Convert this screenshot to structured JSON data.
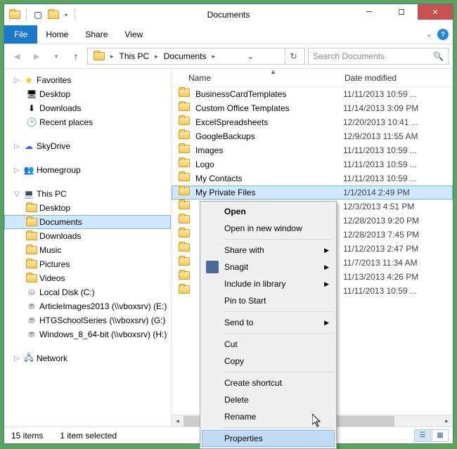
{
  "window": {
    "title": "Documents"
  },
  "ribbon": {
    "file": "File",
    "tabs": [
      "Home",
      "Share",
      "View"
    ]
  },
  "breadcrumb": {
    "root": "This PC",
    "folder": "Documents"
  },
  "search": {
    "placeholder": "Search Documents"
  },
  "nav": {
    "favorites": {
      "label": "Favorites",
      "items": [
        "Desktop",
        "Downloads",
        "Recent places"
      ]
    },
    "skydrive": {
      "label": "SkyDrive"
    },
    "homegroup": {
      "label": "Homegroup"
    },
    "thispc": {
      "label": "This PC",
      "items": [
        "Desktop",
        "Documents",
        "Downloads",
        "Music",
        "Pictures",
        "Videos",
        "Local Disk (C:)",
        "ArticleImages2013 (\\\\vboxsrv) (E:)",
        "HTGSchoolSeries (\\\\vboxsrv) (G:)",
        "Windows_8_64-bit (\\\\vboxsrv) (H:)"
      ]
    },
    "network": {
      "label": "Network"
    }
  },
  "columns": {
    "name": "Name",
    "date": "Date modified"
  },
  "files": [
    {
      "name": "BusinessCardTemplates",
      "date": "11/11/2013 10:59 ..."
    },
    {
      "name": "Custom Office Templates",
      "date": "11/14/2013 3:09 PM"
    },
    {
      "name": "ExcelSpreadsheets",
      "date": "12/20/2013 10:41 ..."
    },
    {
      "name": "GoogleBackups",
      "date": "12/9/2013 11:55 AM"
    },
    {
      "name": "Images",
      "date": "11/11/2013 10:59 ..."
    },
    {
      "name": "Logo",
      "date": "11/11/2013 10:59 ..."
    },
    {
      "name": "My Contacts",
      "date": "11/11/2013 10:59 ..."
    },
    {
      "name": "My Private Files",
      "date": "1/1/2014 2:49 PM"
    },
    {
      "name": "",
      "date": "12/3/2013 4:51 PM"
    },
    {
      "name": "",
      "date": "12/28/2013 9:20 PM"
    },
    {
      "name": "",
      "date": "12/28/2013 7:45 PM"
    },
    {
      "name": "",
      "date": "11/12/2013 2:47 PM"
    },
    {
      "name": "",
      "date": "11/7/2013 11:34 AM"
    },
    {
      "name": "",
      "date": "11/13/2013 4:26 PM"
    },
    {
      "name": "",
      "date": "11/11/2013 10:59 ..."
    }
  ],
  "selected_file_index": 7,
  "context_menu": {
    "items": [
      {
        "label": "Open",
        "bold": true
      },
      {
        "label": "Open in new window"
      },
      {
        "sep": true
      },
      {
        "label": "Share with",
        "sub": true
      },
      {
        "label": "Snagit",
        "sub": true,
        "icon": true
      },
      {
        "label": "Include in library",
        "sub": true
      },
      {
        "label": "Pin to Start"
      },
      {
        "sep": true
      },
      {
        "label": "Send to",
        "sub": true
      },
      {
        "sep": true
      },
      {
        "label": "Cut"
      },
      {
        "label": "Copy"
      },
      {
        "sep": true
      },
      {
        "label": "Create shortcut"
      },
      {
        "label": "Delete"
      },
      {
        "label": "Rename"
      },
      {
        "sep": true
      },
      {
        "label": "Properties",
        "hover": true
      }
    ]
  },
  "status": {
    "count": "15 items",
    "selected": "1 item selected"
  }
}
